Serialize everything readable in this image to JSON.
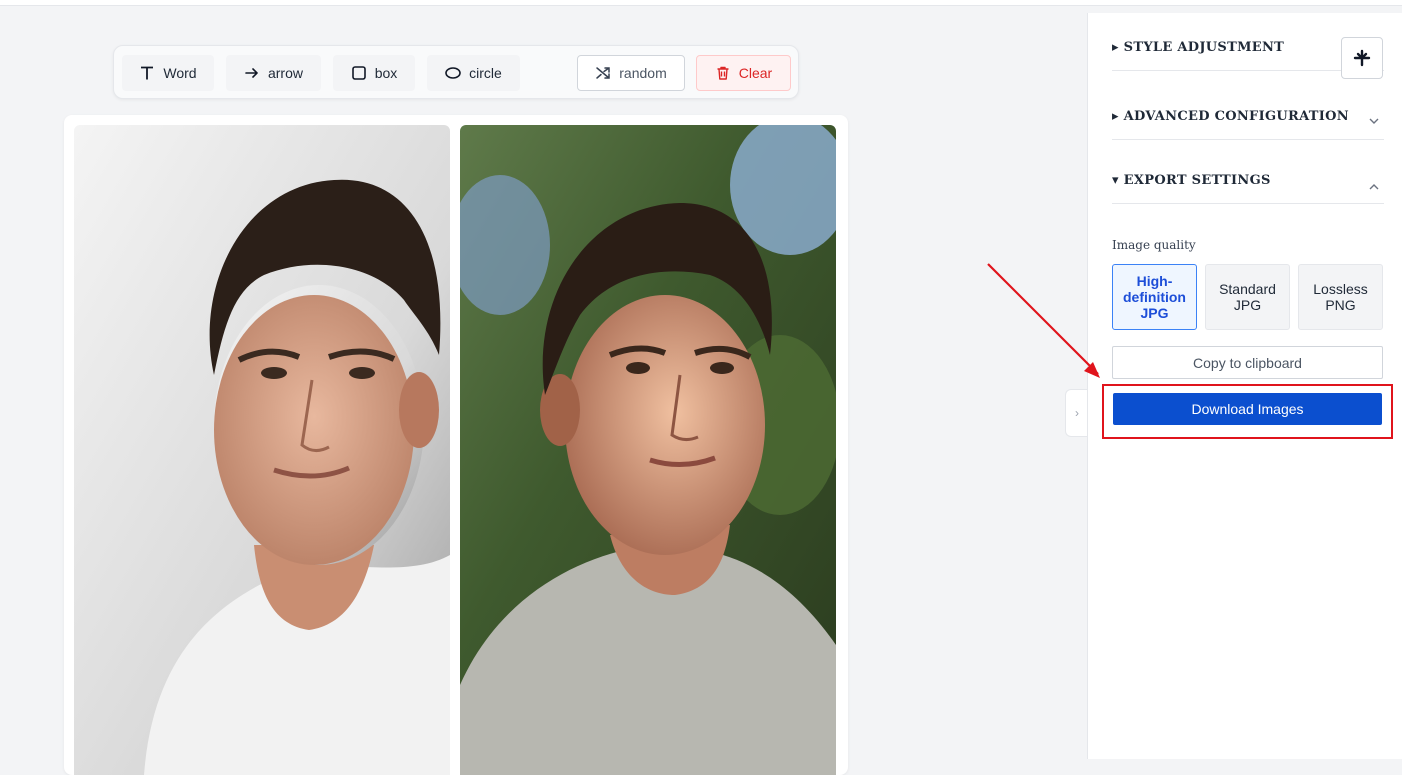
{
  "toolbar": {
    "word_label": "Word",
    "arrow_label": "arrow",
    "box_label": "box",
    "circle_label": "circle",
    "random_label": "random",
    "clear_label": "Clear"
  },
  "images": [
    {
      "alt": "portrait-studio"
    },
    {
      "alt": "portrait-outdoor"
    }
  ],
  "sidebar": {
    "sections": [
      {
        "title": "STYLE ADJUSTMENT",
        "expanded": false
      },
      {
        "title": "ADVANCED CONFIGURATION",
        "expanded": false
      },
      {
        "title": "EXPORT SETTINGS",
        "expanded": true
      }
    ],
    "image_quality_label": "Image quality",
    "quality_options": [
      {
        "label": "High-definition JPG",
        "selected": true
      },
      {
        "label": "Standard JPG",
        "selected": false
      },
      {
        "label": "Lossless PNG",
        "selected": false
      }
    ],
    "copy_label": "Copy to clipboard",
    "download_label": "Download Images"
  },
  "colors": {
    "accent": "#0b4fcf",
    "highlight": "#e0141c",
    "danger": "#dc2626"
  }
}
